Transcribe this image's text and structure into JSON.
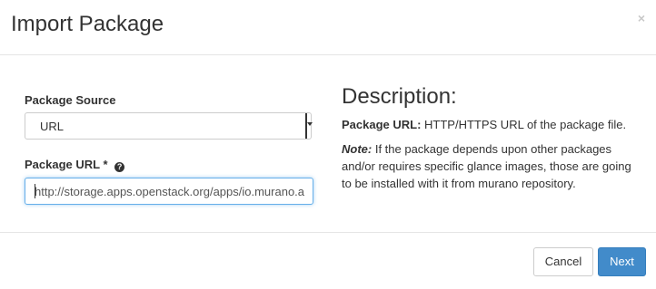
{
  "dialog": {
    "title": "Import Package",
    "close_label": "×"
  },
  "form": {
    "package_source": {
      "label": "Package Source",
      "selected": "URL"
    },
    "package_url": {
      "label": "Package URL",
      "required_mark": "*",
      "help_icon": "?",
      "value": "http://storage.apps.openstack.org/apps/io.murano.a"
    }
  },
  "description": {
    "title": "Description:",
    "url_label": "Package URL:",
    "url_text": " HTTP/HTTPS URL of the package file.",
    "note_label": "Note:",
    "note_text": " If the package depends upon other packages and/or requires specific glance images, those are going to be installed with it from murano repository."
  },
  "footer": {
    "cancel_label": "Cancel",
    "next_label": "Next"
  },
  "colors": {
    "primary": "#428bca",
    "focus_border": "#66afe9"
  }
}
